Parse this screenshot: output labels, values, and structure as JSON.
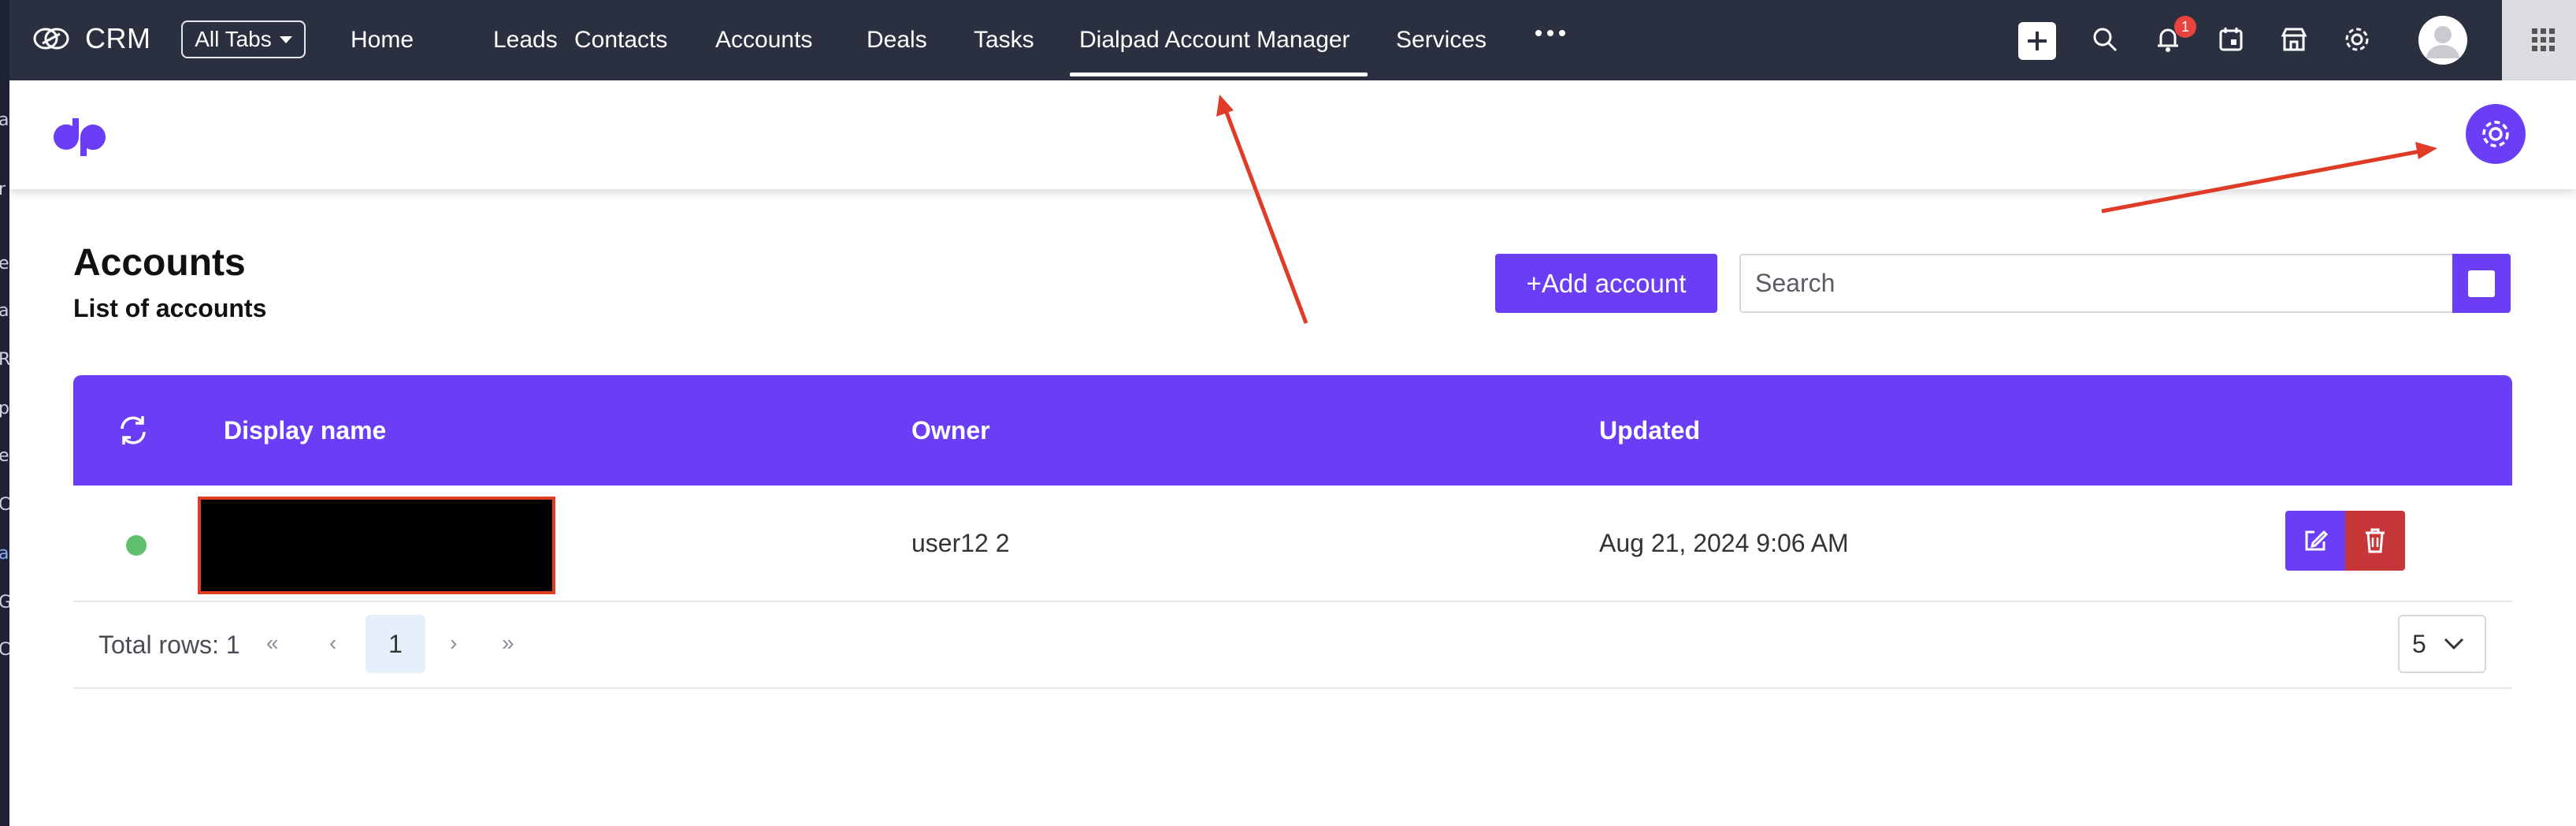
{
  "topnav": {
    "brand": "CRM",
    "all_tabs": "All Tabs",
    "tabs": [
      {
        "label": "Home"
      },
      {
        "label": "Leads"
      },
      {
        "label": "Contacts"
      },
      {
        "label": "Accounts"
      },
      {
        "label": "Deals"
      },
      {
        "label": "Tasks"
      },
      {
        "label": "Dialpad Account Manager"
      },
      {
        "label": "Services"
      }
    ],
    "active_tab": "Dialpad Account Manager",
    "notification_count": "1"
  },
  "left_strip_fragments": [
    "a",
    "r",
    "er",
    "al",
    "R",
    "pa",
    "er",
    "C",
    "a",
    "G",
    "Co"
  ],
  "page": {
    "title": "Accounts",
    "subtitle": "List of accounts",
    "add_button": "+Add account",
    "search_placeholder": "Search"
  },
  "table": {
    "columns": [
      "Display name",
      "Owner",
      "Updated"
    ],
    "rows": [
      {
        "status": "active",
        "display_name": "",
        "owner": "user12 2",
        "updated": "Aug 21, 2024 9:06 AM"
      }
    ]
  },
  "pager": {
    "total_rows": "Total rows: 1",
    "first": "«",
    "prev": "‹",
    "current_page": "1",
    "next": "›",
    "last": "»",
    "page_size": "5"
  },
  "colors": {
    "accent": "#6b3ef5",
    "topnav": "#2b3040",
    "danger": "#c7373a",
    "status_active": "#5fbf6b",
    "annotation": "#e03b26"
  }
}
